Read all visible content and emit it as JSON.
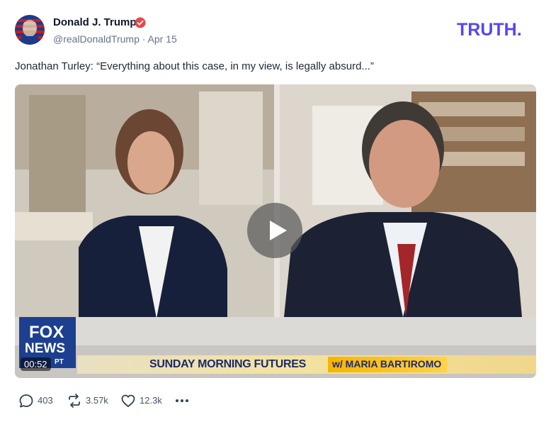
{
  "author": {
    "name": "Donald J. Trump",
    "handle": "@realDonaldTrump",
    "separator": "·",
    "date": "Apr 15",
    "verified_color": "#e5484d"
  },
  "brand": {
    "logo_text": "TRUTH.",
    "color": "#5448ee"
  },
  "post": {
    "text": "Jonathan Turley: “Everything about this case, in my view, is legally absurd...”"
  },
  "video": {
    "duration": "00:52",
    "play_icon": "play-icon",
    "overlay": {
      "network_logo": "FOX NEWS",
      "timezone": "PT",
      "program_title": "SUNDAY MORNING FUTURES",
      "host_tag": "w/ MARIA BARTIROMO"
    }
  },
  "actions": [
    {
      "name": "reply",
      "icon": "reply-icon",
      "count": "403"
    },
    {
      "name": "retruth",
      "icon": "retruth-icon",
      "count": "3.57k"
    },
    {
      "name": "like",
      "icon": "heart-icon",
      "count": "12.3k"
    },
    {
      "name": "more",
      "icon": "more-icon",
      "count": ""
    }
  ]
}
